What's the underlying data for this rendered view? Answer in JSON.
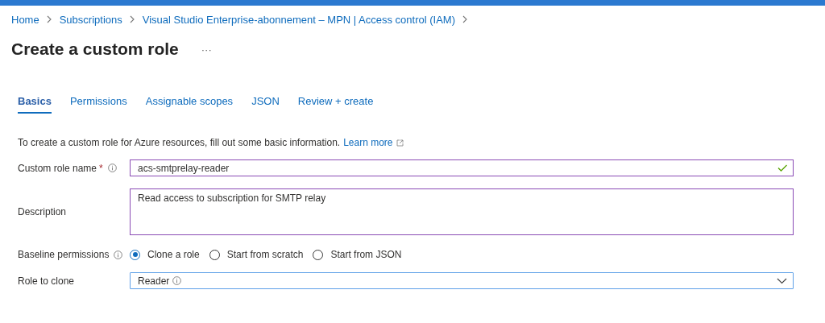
{
  "breadcrumb": [
    {
      "label": "Home"
    },
    {
      "label": "Subscriptions"
    },
    {
      "label": "Visual Studio Enterprise-abonnement – MPN | Access control (IAM)"
    }
  ],
  "title": "Create a custom role",
  "more_button": "···",
  "tabs": [
    {
      "label": "Basics",
      "selected": true
    },
    {
      "label": "Permissions",
      "selected": false
    },
    {
      "label": "Assignable scopes",
      "selected": false
    },
    {
      "label": "JSON",
      "selected": false
    },
    {
      "label": "Review + create",
      "selected": false
    }
  ],
  "intro": {
    "text": "To create a custom role for Azure resources, fill out some basic information.",
    "link": "Learn more"
  },
  "fields": [
    {
      "kind": "text",
      "label": "Custom role name",
      "required_mark": "*",
      "info": true,
      "value": "acs-smtprelay-reader",
      "valid": true
    },
    {
      "kind": "textarea",
      "label": "Description",
      "info": false,
      "value": "Read access to subscription for SMTP relay"
    },
    {
      "kind": "radio",
      "label": "Baseline permissions",
      "info": true,
      "options": [
        {
          "label": "Clone a role",
          "selected": true
        },
        {
          "label": "Start from scratch",
          "selected": false
        },
        {
          "label": "Start from JSON",
          "selected": false
        }
      ]
    },
    {
      "kind": "dropdown",
      "label": "Role to clone",
      "info": false,
      "value": "Reader",
      "value_info": true
    }
  ]
}
